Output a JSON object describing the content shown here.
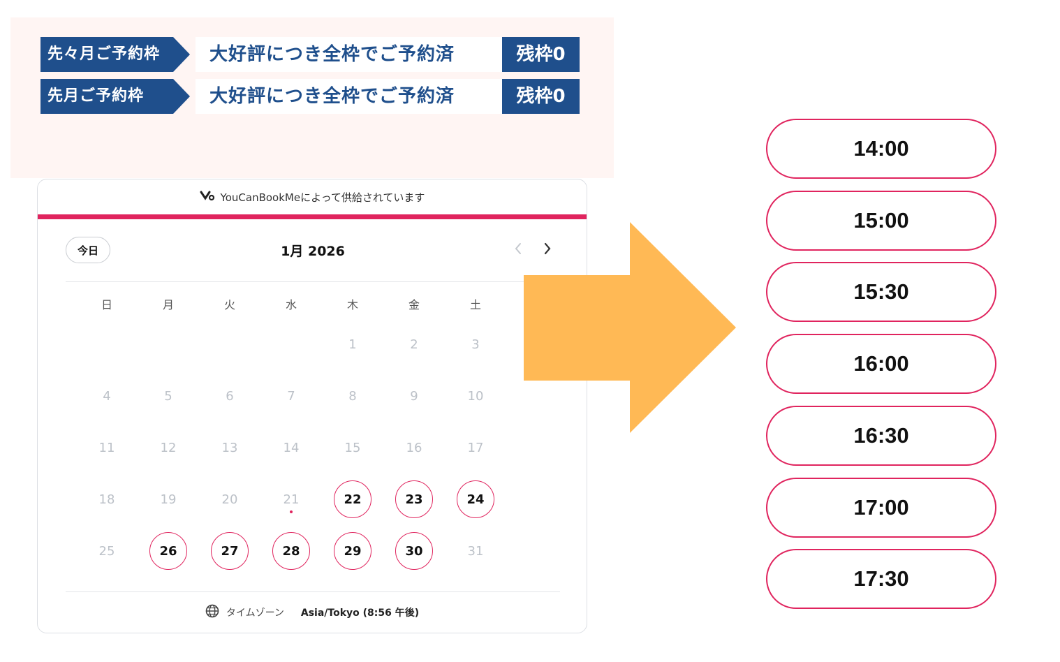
{
  "notice": {
    "rows": [
      {
        "period": "先々月ご予約枠",
        "message": "大好評につき全枠でご予約済",
        "remaining": "残枠0"
      },
      {
        "period": "先月ご予約枠",
        "message": "大好評につき全枠でご予約済",
        "remaining": "残枠0"
      }
    ],
    "colors": {
      "navy": "#1f4f8c",
      "background": "#fff5f3"
    }
  },
  "calendar": {
    "powered_by": "YouCanBookMeによって供給されています",
    "today_label": "今日",
    "month_label": "1月 2026",
    "weekdays": [
      "日",
      "月",
      "火",
      "水",
      "木",
      "金",
      "土"
    ],
    "weeks": [
      [
        "",
        "",
        "",
        "",
        "1",
        "2",
        "3"
      ],
      [
        "4",
        "5",
        "6",
        "7",
        "8",
        "9",
        "10"
      ],
      [
        "11",
        "12",
        "13",
        "14",
        "15",
        "16",
        "17"
      ],
      [
        "18",
        "19",
        "20",
        "21",
        "22",
        "23",
        "24"
      ],
      [
        "25",
        "26",
        "27",
        "28",
        "29",
        "30",
        "31"
      ]
    ],
    "available_days": [
      "22",
      "23",
      "24",
      "26",
      "27",
      "28",
      "29",
      "30"
    ],
    "current_day": "21",
    "timezone_label": "タイムゾーン",
    "timezone_value": "Asia/Tokyo (8:56 午後)",
    "accent_color": "#e0245e"
  },
  "arrow_color": "#ffb955",
  "time_slots": [
    "14:00",
    "15:00",
    "15:30",
    "16:00",
    "16:30",
    "17:00",
    "17:30"
  ]
}
